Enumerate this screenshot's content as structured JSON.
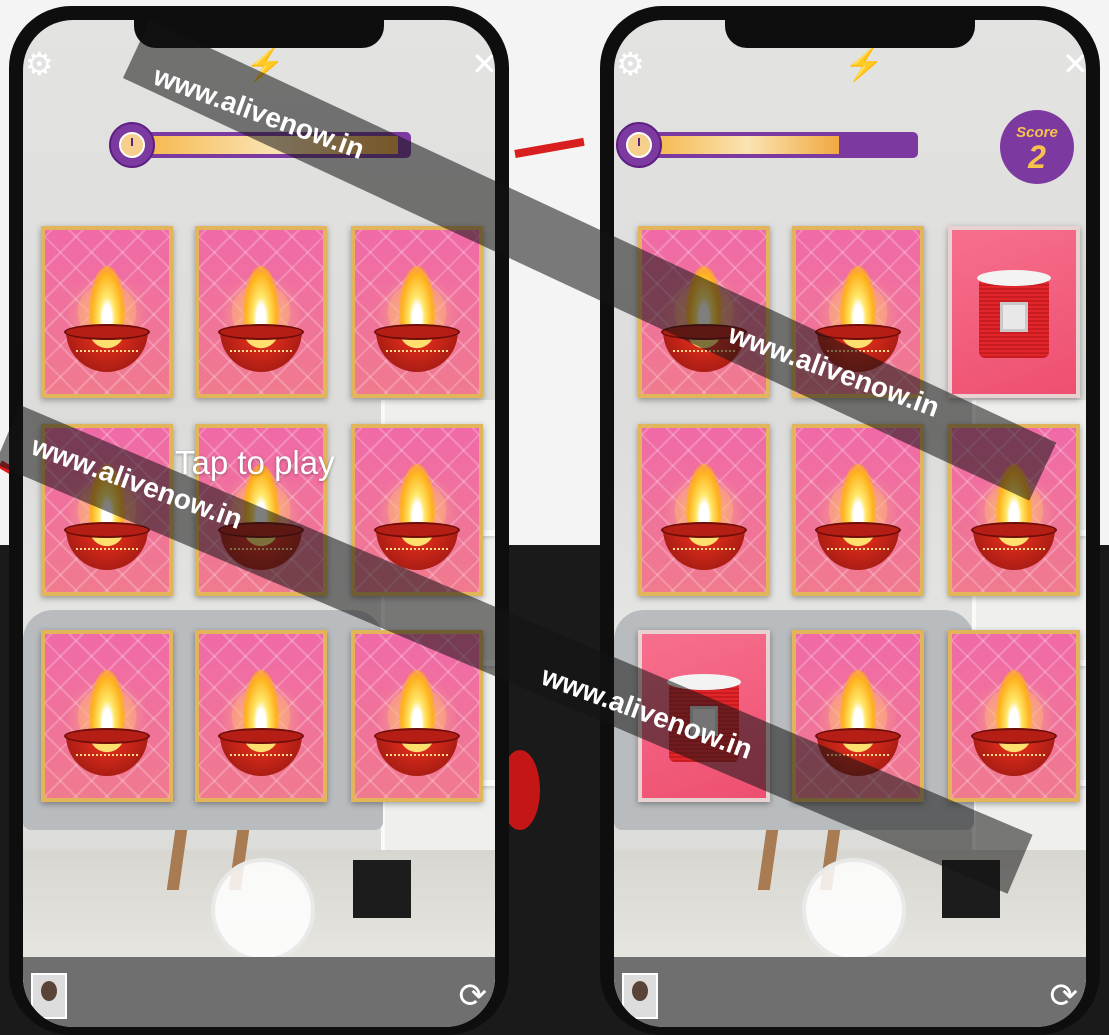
{
  "watermark": {
    "text": "www.alivenow.in"
  },
  "left_screen": {
    "prompt": "Tap to play",
    "timer_progress": 0.95,
    "cards": [
      "diya",
      "diya",
      "diya",
      "diya",
      "diya",
      "diya",
      "diya",
      "diya",
      "diya"
    ]
  },
  "right_screen": {
    "score_label": "Score",
    "score_value": "2",
    "timer_progress": 0.7,
    "cards": [
      "diya",
      "diya",
      "candle",
      "diya",
      "diya",
      "diya",
      "candle",
      "diya",
      "diya"
    ]
  },
  "icons": {
    "settings": "gear-icon",
    "flash": "flash-icon",
    "close": "close-icon",
    "timer": "stopwatch-icon",
    "flip_camera": "camera-flip-icon"
  },
  "colors": {
    "accent": "#7c3aa0",
    "score_text": "#f7c24c",
    "card": "#f25f9e",
    "card_border": "#e2b55b"
  }
}
